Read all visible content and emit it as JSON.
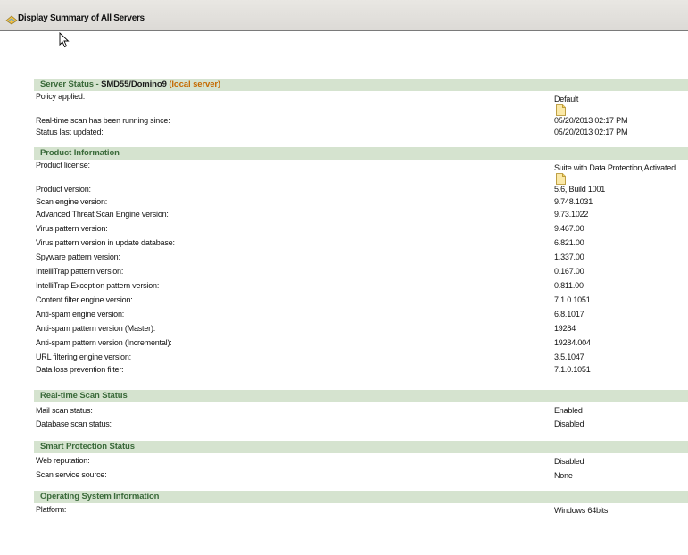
{
  "window": {
    "title": "Display Summary of All Servers",
    "icon": "servers-icon"
  },
  "server_status": {
    "header_prefix": "Server Status - ",
    "server_name": "SMD55/Domino9",
    "server_note": " (local server)",
    "rows": [
      {
        "label": "Policy applied:",
        "value": "Default",
        "icon": "document-icon"
      },
      {
        "label": "Real-time scan has been running since:",
        "value": "05/20/2013 02:17 PM"
      },
      {
        "label": "Status last updated:",
        "value": "05/20/2013 02:17 PM"
      }
    ]
  },
  "product_info": {
    "header": "Product Information",
    "rows": [
      {
        "label": "Product license:",
        "value": "Suite with Data Protection,Activated",
        "icon": "document-icon"
      },
      {
        "label": "Product version:",
        "value": "5.6, Build 1001"
      },
      {
        "label": "Scan engine version:",
        "value": "9.748.1031"
      },
      {
        "label": "Advanced Threat Scan Engine version:",
        "value": "9.73.1022"
      },
      {
        "label": "Virus pattern version:",
        "value": "9.467.00"
      },
      {
        "label": "Virus pattern version in update database:",
        "value": "6.821.00"
      },
      {
        "label": "Spyware pattern version:",
        "value": "1.337.00"
      },
      {
        "label": "IntelliTrap pattern version:",
        "value": "0.167.00"
      },
      {
        "label": "IntelliTrap Exception pattern version:",
        "value": "0.811.00"
      },
      {
        "label": "Content filter engine version:",
        "value": "7.1.0.1051"
      },
      {
        "label": "Anti-spam engine version:",
        "value": "6.8.1017"
      },
      {
        "label": "Anti-spam pattern version (Master):",
        "value": "19284"
      },
      {
        "label": "Anti-spam pattern version (Incremental):",
        "value": "19284.004"
      },
      {
        "label": "URL filtering engine version:",
        "value": "3.5.1047"
      },
      {
        "label": "Data loss prevention filter:",
        "value": "7.1.0.1051"
      }
    ]
  },
  "realtime_scan": {
    "header": "Real-time Scan Status",
    "rows": [
      {
        "label": "Mail scan status:",
        "value": "Enabled"
      },
      {
        "label": "Database scan status:",
        "value": "Disabled"
      }
    ]
  },
  "smart_protection": {
    "header": "Smart Protection Status",
    "rows": [
      {
        "label": "Web reputation:",
        "value": "Disabled"
      },
      {
        "label": "Scan service source:",
        "value": "None"
      }
    ]
  },
  "os_info": {
    "header": "Operating System Information",
    "rows": [
      {
        "label": "Platform:",
        "value": "Windows 64bits"
      }
    ]
  },
  "colors": {
    "section_header_bg": "#d5e3cf",
    "section_header_text": "#3a6a3a",
    "server_note": "#c56a00"
  }
}
